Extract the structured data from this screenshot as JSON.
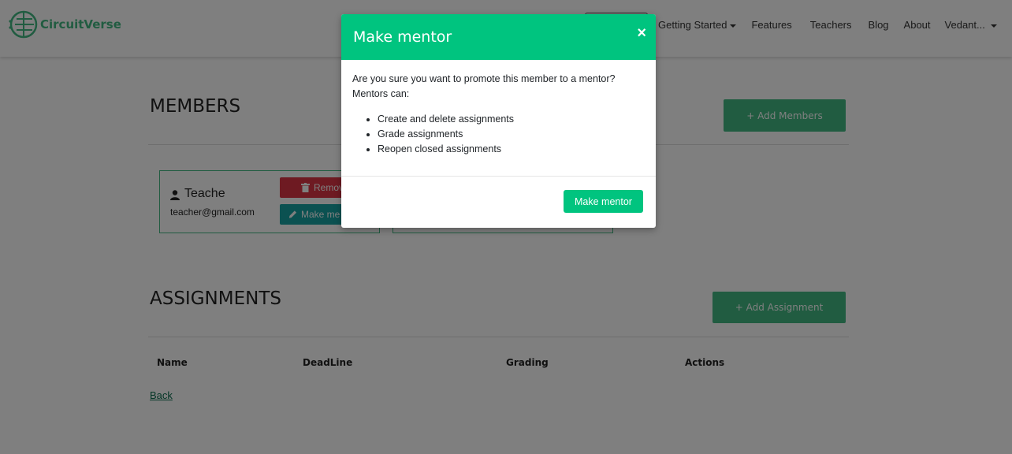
{
  "navbar": {
    "brand": "CircuitVerse",
    "items": [
      {
        "label": "Getting Started",
        "dropdown": true
      },
      {
        "label": "Features",
        "dropdown": false
      },
      {
        "label": "Teachers",
        "dropdown": false
      },
      {
        "label": "Blog",
        "dropdown": false
      },
      {
        "label": "About",
        "dropdown": false
      },
      {
        "label": "Vedant...",
        "dropdown": true
      }
    ]
  },
  "members": {
    "title": "MEMBERS",
    "add_button": "+ Add Members",
    "cards": [
      {
        "name": "Teache",
        "email": "teacher@gmail.com",
        "remove_label": "Remov",
        "make_mentor_label": "Make me"
      }
    ]
  },
  "assignments": {
    "title": "ASSIGNMENTS",
    "add_button": "+ Add Assignment",
    "columns": [
      "Name",
      "DeadLine",
      "Grading",
      "Actions"
    ]
  },
  "back_link": "Back",
  "modal": {
    "title": "Make mentor",
    "close_glyph": "×",
    "question": "Are you sure you want to promote this member to a mentor?",
    "intro": "Mentors can:",
    "abilities": [
      "Create and delete assignments",
      "Grade assignments",
      "Reopen closed assignments"
    ],
    "confirm_button": "Make mentor"
  },
  "colors": {
    "brand_green": "#42b983",
    "modal_header": "#00c47f",
    "danger": "#dc3545",
    "teal": "#17a2a2"
  }
}
